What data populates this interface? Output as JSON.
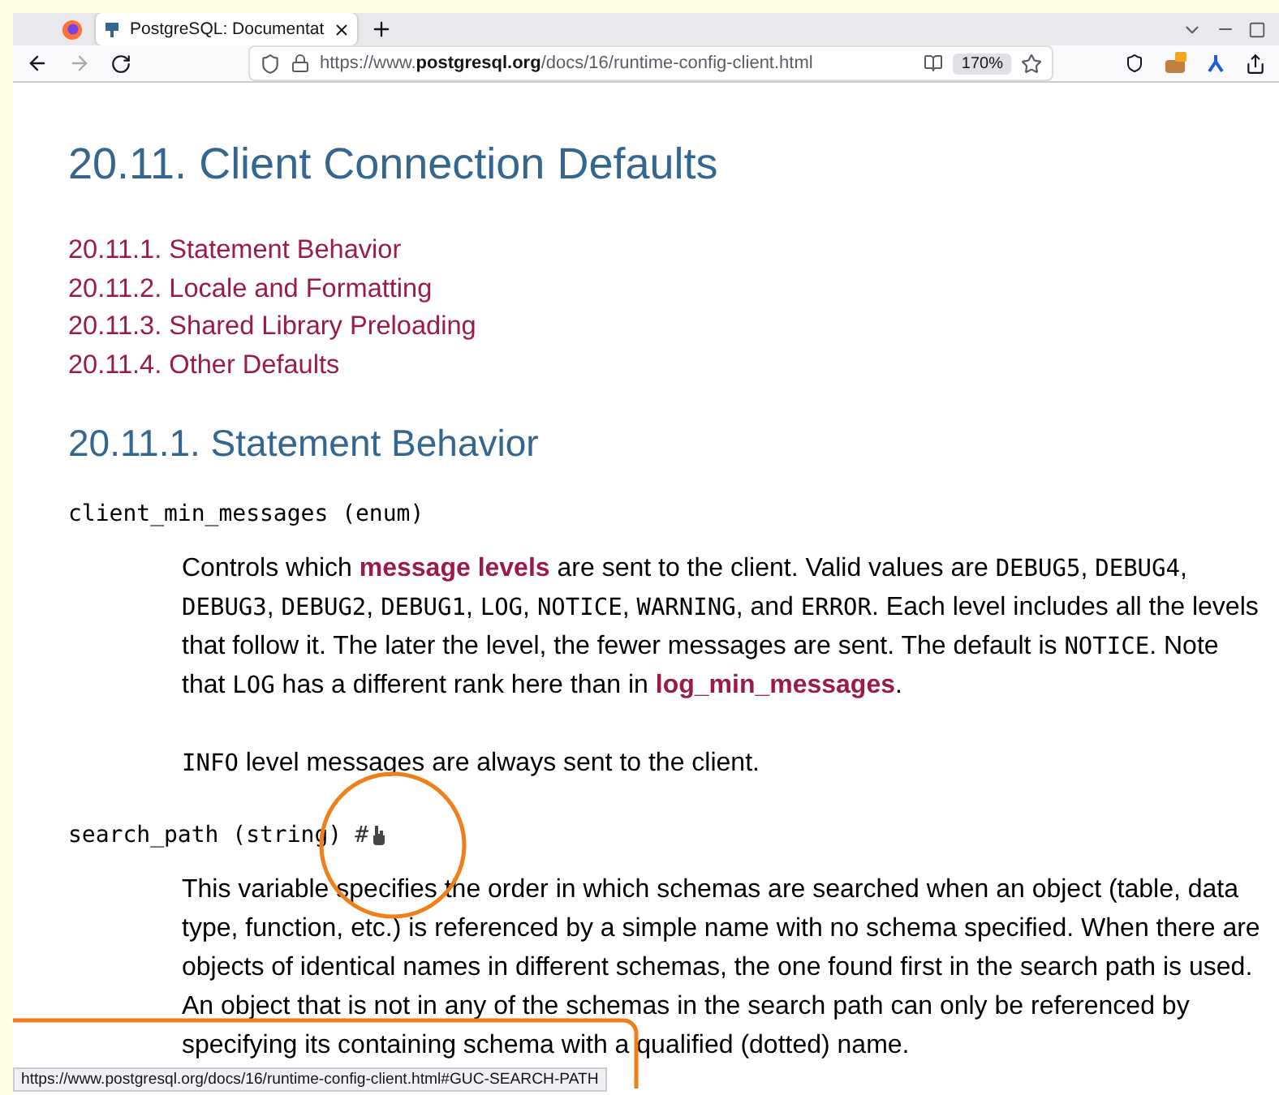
{
  "browser": {
    "tabs": [
      {
        "title": "PostgreSQL: Documentat",
        "selected": true
      }
    ],
    "url": {
      "prefix": "https://www.",
      "host": "postgresql.org",
      "path": "/docs/16/runtime-config-client.html"
    },
    "zoom": "170%"
  },
  "page": {
    "title": "20.11. Client Connection Defaults",
    "toc": [
      "20.11.1. Statement Behavior",
      "20.11.2. Locale and Formatting",
      "20.11.3. Shared Library Preloading",
      "20.11.4. Other Defaults"
    ],
    "section_title": "20.11.1. Statement Behavior",
    "entries": [
      {
        "term": "client_min_messages (enum)",
        "paragraphs": [
          [
            {
              "kind": "text",
              "text": "Controls which "
            },
            {
              "kind": "link",
              "text": "message levels"
            },
            {
              "kind": "text",
              "text": " are sent to the client. Valid values are "
            },
            {
              "kind": "code",
              "text": "DEBUG5"
            },
            {
              "kind": "text",
              "text": ", "
            },
            {
              "kind": "code",
              "text": "DEBUG4"
            },
            {
              "kind": "text",
              "text": ", "
            },
            {
              "kind": "code",
              "text": "DEBUG3"
            },
            {
              "kind": "text",
              "text": ", "
            },
            {
              "kind": "code",
              "text": "DEBUG2"
            },
            {
              "kind": "text",
              "text": ", "
            },
            {
              "kind": "code",
              "text": "DEBUG1"
            },
            {
              "kind": "text",
              "text": ", "
            },
            {
              "kind": "code",
              "text": "LOG"
            },
            {
              "kind": "text",
              "text": ", "
            },
            {
              "kind": "code",
              "text": "NOTICE"
            },
            {
              "kind": "text",
              "text": ", "
            },
            {
              "kind": "code",
              "text": "WARNING"
            },
            {
              "kind": "text",
              "text": ", and "
            },
            {
              "kind": "code",
              "text": "ERROR"
            },
            {
              "kind": "text",
              "text": ". Each level includes all the levels that follow it. The later the level, the fewer messages are sent. The default is "
            },
            {
              "kind": "code",
              "text": "NOTICE"
            },
            {
              "kind": "text",
              "text": ". Note that "
            },
            {
              "kind": "code",
              "text": "LOG"
            },
            {
              "kind": "text",
              "text": " has a different rank here than in "
            },
            {
              "kind": "link",
              "text": "log_min_messages"
            },
            {
              "kind": "text",
              "text": "."
            }
          ],
          [
            {
              "kind": "code",
              "text": "INFO"
            },
            {
              "kind": "text",
              "text": " level messages are always sent to the client."
            }
          ]
        ]
      },
      {
        "term": "search_path (string)",
        "anchor": "#",
        "paragraphs": [
          [
            {
              "kind": "text",
              "text": "This variable specifies the order in which schemas are searched when an object (table, data type, function, etc.) is referenced by a simple name with no schema specified. When there are objects of identical names in different schemas, the one found first in the search path is used. An object that is not in any of the schemas in the search path can only be referenced by specifying its containing schema with a qualified (dotted) name."
            }
          ]
        ]
      }
    ]
  },
  "status_bar": "https://www.postgresql.org/docs/16/runtime-config-client.html#GUC-SEARCH-PATH"
}
